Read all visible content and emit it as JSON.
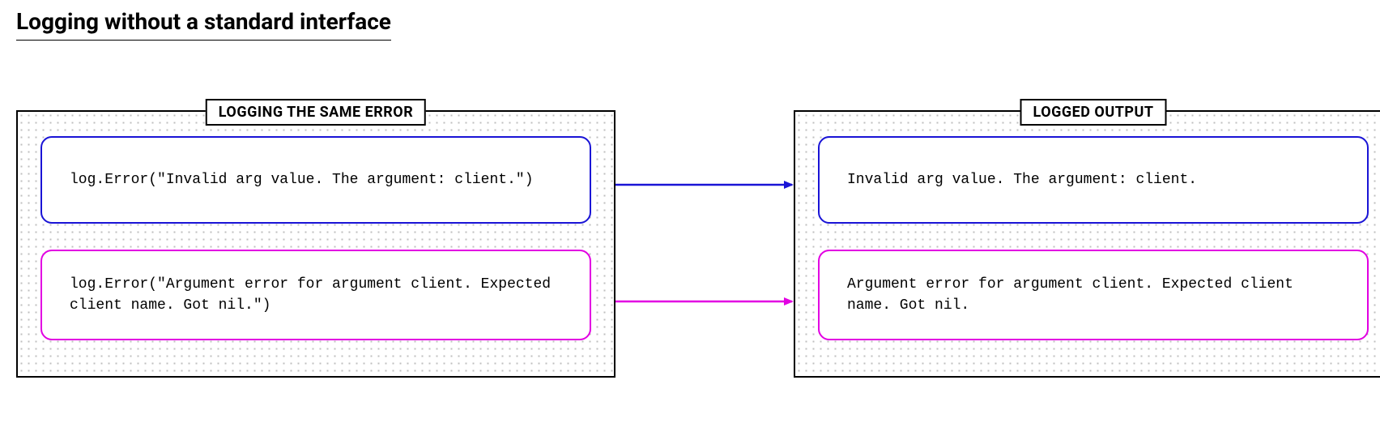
{
  "title": "Logging without a standard interface",
  "leftPanel": {
    "label": "LOGGING THE SAME ERROR",
    "box1": "log.Error(\"Invalid arg value. The argument: client.\")",
    "box2": "log.Error(\"Argument error for argument client. Expected client name. Got nil.\")"
  },
  "rightPanel": {
    "label": "LOGGED OUTPUT",
    "box1": "Invalid arg value. The argument: client.",
    "box2": "Argument error for argument client. Expected client name. Got nil."
  },
  "colors": {
    "blue": "#1a14d6",
    "pink": "#e200e2"
  }
}
